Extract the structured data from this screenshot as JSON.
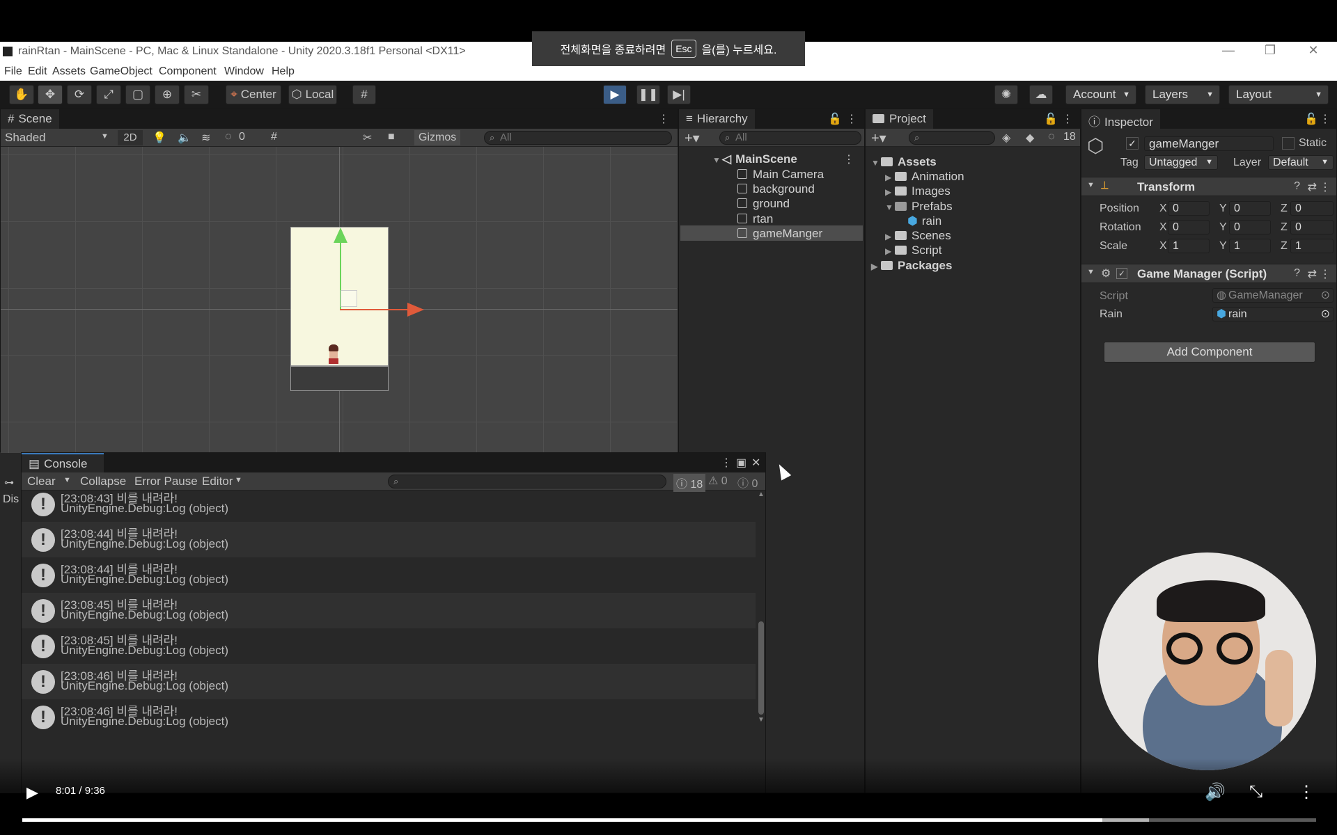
{
  "window": {
    "title": "rainRtan - MainScene - PC, Mac & Linux Standalone - Unity 2020.3.18f1 Personal <DX11>",
    "minimize": "—",
    "restore": "❐",
    "close": "✕"
  },
  "fullscreen_notice": {
    "before": "전체화면을 종료하려면",
    "key": "Esc",
    "after": "을(를) 누르세요."
  },
  "menu": [
    "File",
    "Edit",
    "Assets",
    "GameObject",
    "Component",
    "Window",
    "Help"
  ],
  "toolbar": {
    "pivot": "Center",
    "space": "Local",
    "account": "Account",
    "layers": "Layers",
    "layout": "Layout"
  },
  "scene": {
    "tab": "Scene",
    "shading": "Shaded",
    "mode2d": "2D",
    "hidden_count": "0",
    "gizmos": "Gizmos",
    "search_placeholder": "All"
  },
  "hierarchy": {
    "tab": "Hierarchy",
    "search_placeholder": "All",
    "scene_name": "MainScene",
    "items": [
      "Main Camera",
      "background",
      "ground",
      "rtan",
      "gameManger"
    ],
    "selected": "gameManger"
  },
  "project": {
    "tab": "Project",
    "hidden_count": "18",
    "tree": [
      {
        "label": "Assets",
        "level": 0,
        "expanded": true,
        "bold": true
      },
      {
        "label": "Animation",
        "level": 1,
        "expanded": false
      },
      {
        "label": "Images",
        "level": 1,
        "expanded": false
      },
      {
        "label": "Prefabs",
        "level": 1,
        "expanded": true
      },
      {
        "label": "rain",
        "level": 2,
        "prefab": true
      },
      {
        "label": "Scenes",
        "level": 1,
        "expanded": false
      },
      {
        "label": "Script",
        "level": 1,
        "expanded": false
      },
      {
        "label": "Packages",
        "level": 0,
        "expanded": false,
        "bold": true
      }
    ]
  },
  "inspector": {
    "tab": "Inspector",
    "object_name": "gameManger",
    "static_label": "Static",
    "tag_label": "Tag",
    "tag_value": "Untagged",
    "layer_label": "Layer",
    "layer_value": "Default",
    "transform": {
      "title": "Transform",
      "position": {
        "label": "Position",
        "x": "0",
        "y": "0",
        "z": "0"
      },
      "rotation": {
        "label": "Rotation",
        "x": "0",
        "y": "0",
        "z": "0"
      },
      "scale": {
        "label": "Scale",
        "x": "1",
        "y": "1",
        "z": "1"
      }
    },
    "component": {
      "title": "Game Manager (Script)",
      "script_label": "Script",
      "script_value": "GameManager",
      "rain_label": "Rain",
      "rain_value": "rain"
    },
    "add_component": "Add Component"
  },
  "console": {
    "tab": "Console",
    "clear": "Clear",
    "collapse": "Collapse",
    "error_pause": "Error Pause",
    "editor": "Editor",
    "log_count": "18",
    "warn_count": "0",
    "error_count": "0",
    "side_label": "Dis",
    "rows": [
      {
        "time": "[23:08:43] 비를 내려라!",
        "detail": "UnityEngine.Debug:Log (object)"
      },
      {
        "time": "[23:08:44] 비를 내려라!",
        "detail": "UnityEngine.Debug:Log (object)"
      },
      {
        "time": "[23:08:44] 비를 내려라!",
        "detail": "UnityEngine.Debug:Log (object)"
      },
      {
        "time": "[23:08:45] 비를 내려라!",
        "detail": "UnityEngine.Debug:Log (object)"
      },
      {
        "time": "[23:08:45] 비를 내려라!",
        "detail": "UnityEngine.Debug:Log (object)"
      },
      {
        "time": "[23:08:46] 비를 내려라!",
        "detail": "UnityEngine.Debug:Log (object)"
      },
      {
        "time": "[23:08:46] 비를 내려라!",
        "detail": "UnityEngine.Debug:Log (object)"
      }
    ]
  },
  "video": {
    "time": "8:01 / 9:36",
    "progress": 0.835
  }
}
